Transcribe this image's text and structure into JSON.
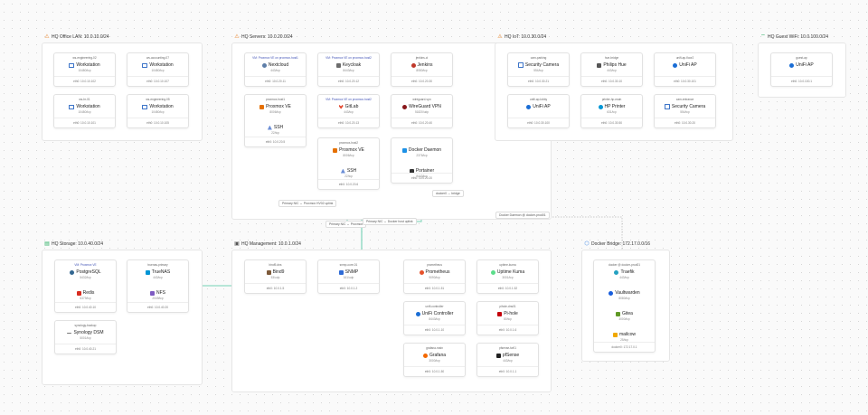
{
  "zones": [
    {
      "id": "office",
      "title": "HQ Office LAN: 10.0.10.0/24",
      "icon": "warning-icon",
      "icon_color": "#e67e22",
      "hosts": [
        {
          "name": "ws-engineering-02",
          "vm": false,
          "services": [
            {
              "name": "Workstation",
              "port": "10480/tcp",
              "icon": "monitor"
            }
          ],
          "addr": "eth0: 10.0.10.102"
        },
        {
          "name": "ws-accounting-07",
          "vm": false,
          "services": [
            {
              "name": "Workstation",
              "port": "10480/tcp",
              "icon": "monitor"
            }
          ],
          "addr": "eth0: 10.0.10.107"
        },
        {
          "name": "ws-hr-01",
          "vm": false,
          "services": [
            {
              "name": "Workstation",
              "port": "10480/tcp",
              "icon": "monitor"
            }
          ],
          "addr": "eth0: 10.0.10.101"
        },
        {
          "name": "ws-engineering-05",
          "vm": false,
          "services": [
            {
              "name": "Workstation",
              "port": "10480/tcp",
              "icon": "monitor"
            }
          ],
          "addr": "eth0: 10.0.10.105"
        }
      ]
    },
    {
      "id": "servers",
      "title": "HQ Servers: 10.0.20.0/24",
      "icon": "warning-icon",
      "icon_color": "#e67e22",
      "hosts": [
        {
          "name": "VM: Proxmox VE on proxmox-host1",
          "vm": true,
          "services": [
            {
              "name": "Nextcloud",
              "port": "443/tcp",
              "icon": "cloud"
            }
          ],
          "addr": "eth0: 10.0.20.11"
        },
        {
          "name": "VM: Proxmox VE on proxmox-host2",
          "vm": true,
          "services": [
            {
              "name": "Keycloak",
              "port": "8443/tcp",
              "icon": "key"
            }
          ],
          "addr": "eth0: 10.0.20.12"
        },
        {
          "name": "jenkins-ci",
          "vm": false,
          "services": [
            {
              "name": "Jenkins",
              "port": "8080/tcp",
              "icon": "jenkins"
            }
          ],
          "addr": "eth0: 10.0.20.30"
        },
        {
          "name": "proxmox-host1",
          "vm": false,
          "services": [
            {
              "name": "Proxmox VE",
              "port": "8006/tcp",
              "icon": "proxmox"
            },
            {
              "name": "SSH",
              "port": "22/tcp",
              "icon": "ssh"
            }
          ],
          "addr": "eth0: 10.0.20.5"
        },
        {
          "name": "VM: Proxmox VE on proxmox-host2",
          "vm": true,
          "services": [
            {
              "name": "GitLab",
              "port": "443/tcp",
              "icon": "gitlab"
            }
          ],
          "addr": "eth0: 10.0.20.13"
        },
        {
          "name": "wireguard-vpn",
          "vm": false,
          "services": [
            {
              "name": "WireGuard VPN",
              "port": "51820/udp",
              "icon": "wg"
            }
          ],
          "addr": "eth0: 10.0.20.40"
        },
        {
          "name": "proxmox-host2",
          "vm": false,
          "services": [
            {
              "name": "Proxmox VE",
              "port": "8006/tcp",
              "icon": "proxmox"
            },
            {
              "name": "SSH",
              "port": "22/tcp",
              "icon": "ssh"
            }
          ],
          "addr": "eth0: 10.0.20.6"
        },
        {
          "name": "",
          "vm": false,
          "services": [
            {
              "name": "Docker Daemon",
              "port": "2376/tcp",
              "icon": "docker"
            },
            {
              "name": "Portainer",
              "port": "9443/tcp",
              "icon": "portainer"
            }
          ],
          "addr": "eth0: 10.0.20.20"
        }
      ]
    },
    {
      "id": "iot",
      "title": "HQ IoT: 10.0.30.0/24",
      "icon": "warning-icon",
      "icon_color": "#e67e22",
      "hosts": [
        {
          "name": "cam-parking",
          "vm": false,
          "services": [
            {
              "name": "Security Camera",
              "port": "554/tcp",
              "icon": "camera"
            }
          ],
          "addr": "eth0: 10.0.30.21"
        },
        {
          "name": "hue-bridge",
          "vm": false,
          "services": [
            {
              "name": "Philips Hue",
              "port": "443/tcp",
              "icon": "hue"
            }
          ],
          "addr": "eth0: 10.0.30.10"
        },
        {
          "name": "unifi-ap-floor2",
          "vm": false,
          "services": [
            {
              "name": "UniFi AP",
              "port": "",
              "icon": "unifi"
            }
          ],
          "addr": "eth0: 10.0.30.101"
        },
        {
          "name": "unifi-ap-lobby",
          "vm": false,
          "services": [
            {
              "name": "UniFi AP",
              "port": "",
              "icon": "unifi"
            }
          ],
          "addr": "eth0: 10.0.30.100"
        },
        {
          "name": "printer-hp-main",
          "vm": false,
          "services": [
            {
              "name": "HP Printer",
              "port": "631/tcp",
              "icon": "hp"
            }
          ],
          "addr": "eth0: 10.0.30.50"
        },
        {
          "name": "cam-entrance",
          "vm": false,
          "services": [
            {
              "name": "Security Camera",
              "port": "554/tcp",
              "icon": "camera"
            }
          ],
          "addr": "eth0: 10.0.30.20"
        }
      ]
    },
    {
      "id": "guest",
      "title": "HQ Guest WiFi: 10.0.100.0/24",
      "icon": "wifi-icon",
      "icon_color": "#27ae60",
      "hosts": [
        {
          "name": "guest-ap",
          "vm": false,
          "services": [
            {
              "name": "UniFi AP",
              "port": "",
              "icon": "unifi"
            }
          ],
          "addr": "eth0: 10.0.100.1"
        }
      ]
    },
    {
      "id": "storage",
      "title": "HQ Storage: 10.0.40.0/24",
      "icon": "storage-icon",
      "icon_color": "#27ae60",
      "hosts": [
        {
          "name": "VM: Proxmox VE",
          "vm": true,
          "services": [
            {
              "name": "PostgreSQL",
              "port": "5432/tcp",
              "icon": "pg"
            },
            {
              "name": "Redis",
              "port": "6379/tcp",
              "icon": "redis"
            }
          ],
          "addr": "eth0: 10.0.40.10"
        },
        {
          "name": "truenas-primary",
          "vm": false,
          "services": [
            {
              "name": "TrueNAS",
              "port": "443/tcp",
              "icon": "truenas"
            },
            {
              "name": "NFS",
              "port": "2049/tcp",
              "icon": "nfs"
            }
          ],
          "addr": "eth0: 10.0.40.20"
        },
        {
          "name": "synology-backup",
          "vm": false,
          "services": [
            {
              "name": "Synology DSM",
              "port": "5001/tcp",
              "icon": "syn"
            }
          ],
          "addr": "eth0: 10.0.40.21"
        }
      ]
    },
    {
      "id": "mgmt",
      "title": "HQ Management: 10.0.1.0/24",
      "icon": "mgmt-icon",
      "icon_color": "#555555",
      "hosts": [
        {
          "name": "bind9-dns",
          "vm": false,
          "services": [
            {
              "name": "Bind9",
              "port": "53/udp",
              "icon": "bind"
            }
          ],
          "addr": "eth0: 10.0.1.5"
        },
        {
          "name": "snmp-core-01",
          "vm": false,
          "services": [
            {
              "name": "SNMP",
              "port": "161/udp",
              "icon": "snmp"
            }
          ],
          "addr": "eth0: 10.0.1.2"
        },
        {
          "name": "prometheus",
          "vm": false,
          "services": [
            {
              "name": "Prometheus",
              "port": "9090/tcp",
              "icon": "prom"
            }
          ],
          "addr": "eth0: 10.0.1.51"
        },
        {
          "name": "uptime-kuma",
          "vm": false,
          "services": [
            {
              "name": "Uptime Kuma",
              "port": "3001/tcp",
              "icon": "kuma"
            }
          ],
          "addr": "eth0: 10.0.1.52"
        },
        {
          "name": "unifi-controller",
          "vm": false,
          "services": [
            {
              "name": "UniFi Controller",
              "port": "8443/tcp",
              "icon": "unifi"
            }
          ],
          "addr": "eth0: 10.0.1.10"
        },
        {
          "name": "pihole-dns01",
          "vm": false,
          "services": [
            {
              "name": "Pi-hole",
              "port": "80/tcp",
              "icon": "pihole"
            }
          ],
          "addr": "eth0: 10.0.1.6"
        },
        {
          "name": "grafana-main",
          "vm": false,
          "services": [
            {
              "name": "Grafana",
              "port": "3000/tcp",
              "icon": "grafana"
            }
          ],
          "addr": "eth0: 10.0.1.50"
        },
        {
          "name": "pfsense-fw01",
          "vm": false,
          "services": [
            {
              "name": "pfSense",
              "port": "443/tcp",
              "icon": "pfsense"
            }
          ],
          "addr": "eth0: 10.0.1.1"
        }
      ]
    },
    {
      "id": "docker",
      "title": "Docker Bridge: 172.17.0.0/16",
      "icon": "docker-bridge-icon",
      "icon_color": "#2c7be5",
      "hosts": [
        {
          "name": "docker @ docker-prod01",
          "vm": false,
          "services": [
            {
              "name": "Traefik",
              "port": "443/tcp",
              "icon": "traefik"
            },
            {
              "name": "Vaultwarden",
              "port": "8080/tcp",
              "icon": "vw"
            },
            {
              "name": "Gitea",
              "port": "3000/tcp",
              "icon": "gitea"
            },
            {
              "name": "mailcow",
              "port": "25/tcp",
              "icon": "mailcow"
            }
          ],
          "addr": "docker0: 172.17.0.1"
        }
      ]
    }
  ],
  "badges": [
    {
      "id": "b1",
      "text": "Primary NIC ↔ Proxmox HV02 uplink"
    },
    {
      "id": "b2",
      "text": "Primary NIC ↔ Proxmox"
    },
    {
      "id": "b3",
      "text": "Primary NIC ↔ Docker host uplink"
    },
    {
      "id": "b4",
      "text": "docker0 ↔ bridge"
    },
    {
      "id": "b5",
      "text": "Docker Daemon @ docker-prod01"
    }
  ],
  "colors": {
    "link": "#8fd9c2",
    "link_strong": "#5cc9a7",
    "dashed": "#9a9a9a",
    "vm_label": "#3f51b5"
  }
}
